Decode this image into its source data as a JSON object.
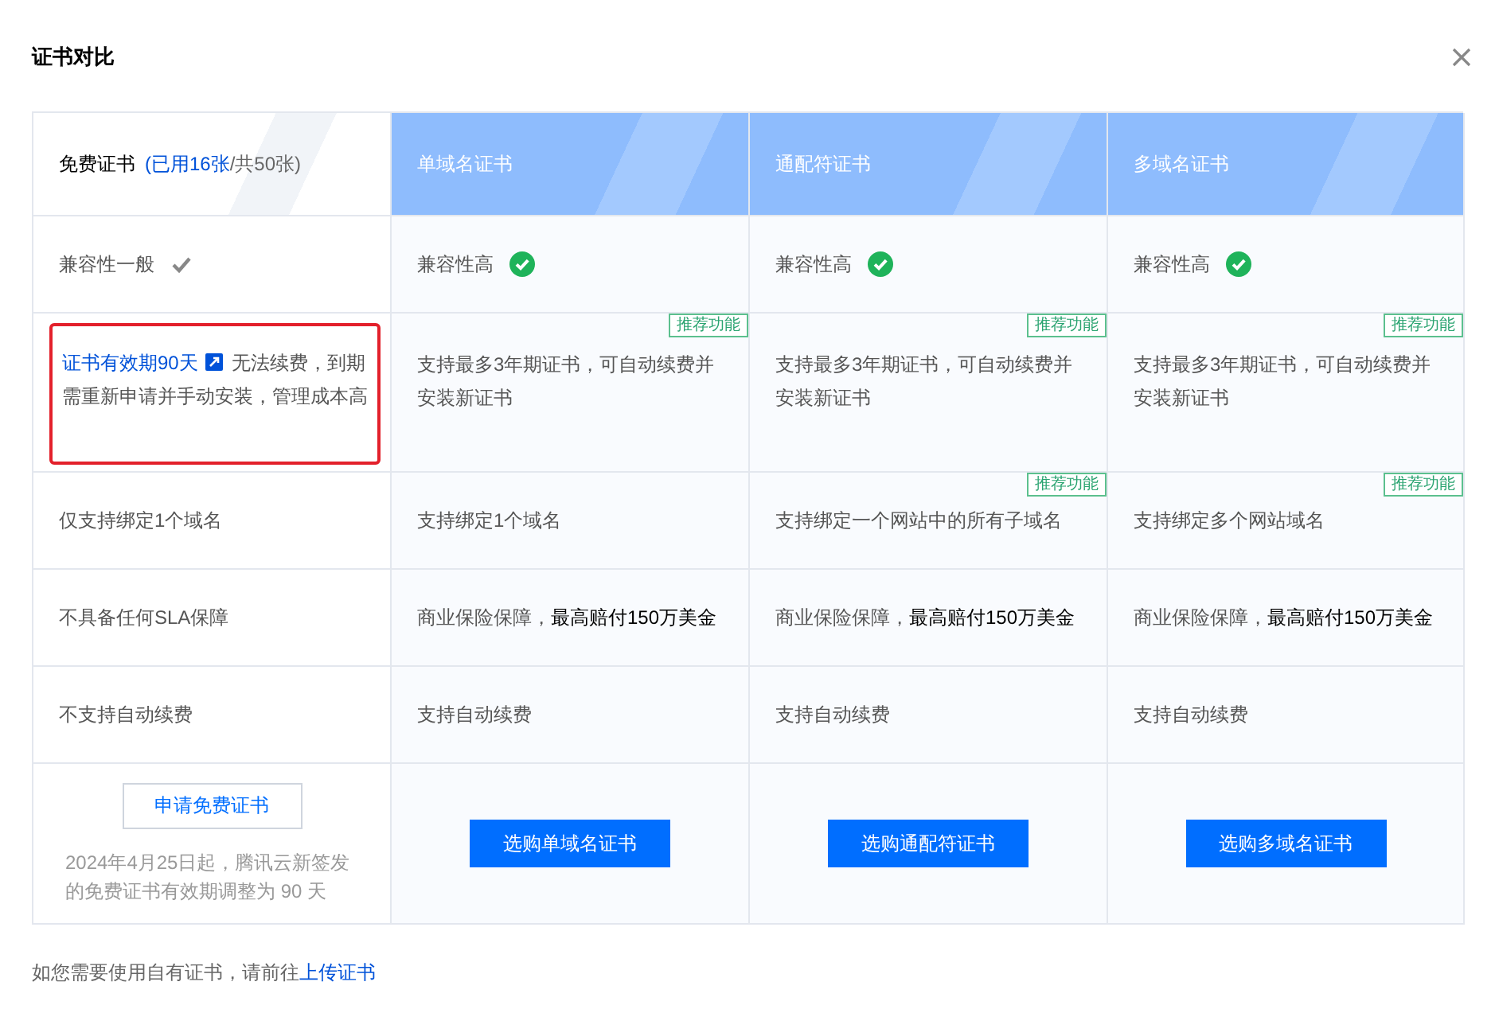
{
  "dialog": {
    "title": "证书对比"
  },
  "table": {
    "header": [
      {
        "kind": "free",
        "label": "免费证书",
        "usage": "(已用16张",
        "quota": "/共50张)"
      },
      {
        "kind": "paid",
        "label": "单域名证书"
      },
      {
        "kind": "paid",
        "label": "通配符证书"
      },
      {
        "kind": "paid",
        "label": "多域名证书"
      }
    ],
    "rows": [
      [
        {
          "text": "兼容性一般",
          "kind": "basic",
          "checked": true
        },
        {
          "text": "兼容性高",
          "kind": "premium",
          "checked": true
        },
        {
          "text": "兼容性高",
          "kind": "premium",
          "checked": true
        },
        {
          "text": "兼容性高",
          "kind": "premium",
          "checked": true
        }
      ],
      [
        {
          "link": "证书有效期90天",
          "text": "无法续费，到期需重新申请并手动安装，管理成本高",
          "highlighted": true
        },
        {
          "text": "支持最多3年期证书，可自动续费并安装新证书",
          "badge": "推荐功能",
          "highlighted": false
        },
        {
          "text": "支持最多3年期证书，可自动续费并安装新证书",
          "badge": "推荐功能",
          "highlighted": false
        },
        {
          "text": "支持最多3年期证书，可自动续费并安装新证书",
          "badge": "推荐功能",
          "highlighted": false
        }
      ],
      [
        {
          "text": "仅支持绑定1个域名"
        },
        {
          "text": "支持绑定1个域名"
        },
        {
          "text": "支持绑定一个网站中的所有子域名",
          "badge": "推荐功能"
        },
        {
          "text": "支持绑定多个网站域名",
          "badge": "推荐功能"
        }
      ],
      [
        {
          "text": "不具备任何SLA保障"
        },
        {
          "text": "商业保险保障，**最高赔付150万美金**"
        },
        {
          "text": "商业保险保障，**最高赔付150万美金**"
        },
        {
          "text": "商业保险保障，**最高赔付150万美金**"
        }
      ],
      [
        {
          "text": "不支持自动续费"
        },
        {
          "text": "支持自动续费"
        },
        {
          "text": "支持自动续费"
        },
        {
          "text": "支持自动续费"
        }
      ]
    ],
    "actions": [
      {
        "kind": "outline",
        "label": "申请免费证书",
        "note": "2024年4月25日起，腾讯云新签发的免费证书有效期调整为 90 天"
      },
      {
        "kind": "primary",
        "label": "选购单域名证书"
      },
      {
        "kind": "primary",
        "label": "选购通配符证书"
      },
      {
        "kind": "primary",
        "label": "选购多域名证书"
      }
    ]
  },
  "footer": {
    "text": "如您需要使用自有证书，请前往",
    "link": "上传证书"
  }
}
